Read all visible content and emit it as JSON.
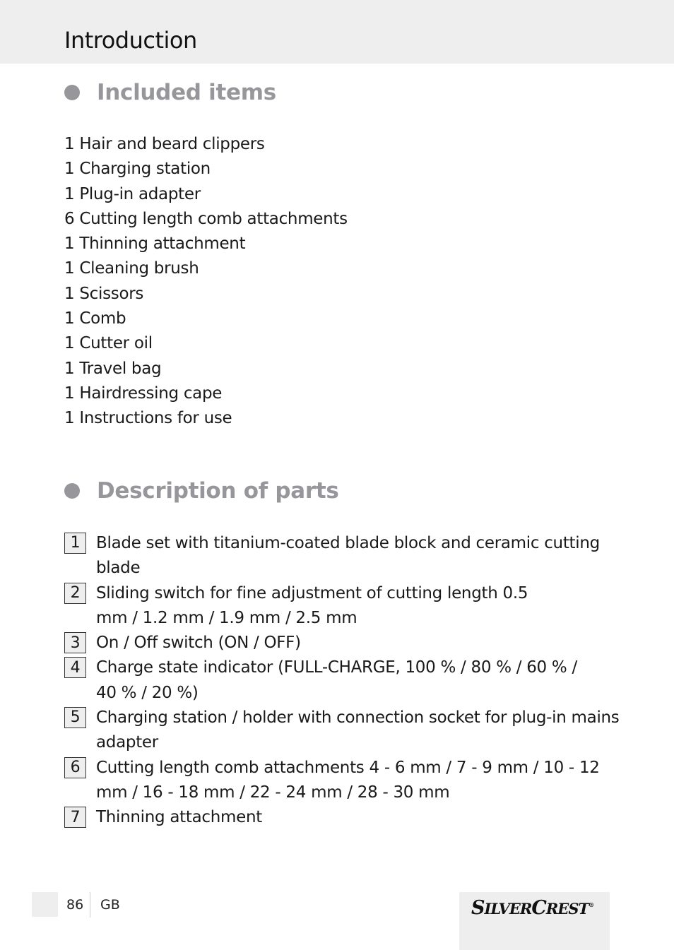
{
  "header": {
    "title": "Introduction"
  },
  "included_items": {
    "heading": "Included items",
    "items": [
      "1 Hair and beard clippers",
      "1 Charging station",
      "1 Plug-in adapter",
      "6 Cutting length comb attachments",
      "1 Thinning attachment",
      "1 Cleaning brush",
      "1 Scissors",
      "1 Comb",
      "1 Cutter oil",
      "1 Travel bag",
      "1 Hairdressing cape",
      "1 Instructions for use"
    ]
  },
  "description_of_parts": {
    "heading": "Description of parts",
    "parts": [
      {
        "num": "1",
        "text": "Blade set with titanium-coated blade block and ceramic cutting blade"
      },
      {
        "num": "2",
        "text": "Sliding switch for fine adjustment of cutting length 0.5 mm / 1.2 mm / 1.9 mm / 2.5 mm"
      },
      {
        "num": "3",
        "text": "On / Off switch (ON / OFF)"
      },
      {
        "num": "4",
        "text": "Charge state indicator (FULL-CHARGE, 100 % / 80 % / 60 % / 40 % / 20 %)"
      },
      {
        "num": "5",
        "text": "Charging station / holder with connection socket for plug-in mains adapter"
      },
      {
        "num": "6",
        "text": "Cutting length comb attachments 4 - 6 mm / 7 - 9 mm / 10 - 12 mm / 16 - 18 mm / 22 - 24 mm / 28 - 30 mm"
      },
      {
        "num": "7",
        "text": "Thinning attachment"
      }
    ]
  },
  "footer": {
    "page_number": "86",
    "language": "GB",
    "brand_first": "S",
    "brand_first_rest": "ILVER",
    "brand_second": "C",
    "brand_second_rest": "REST",
    "brand_mark": "®"
  },
  "colors": {
    "heading_gray": "#97979b",
    "band_gray": "#edeeed",
    "text": "#1a1a1a"
  }
}
